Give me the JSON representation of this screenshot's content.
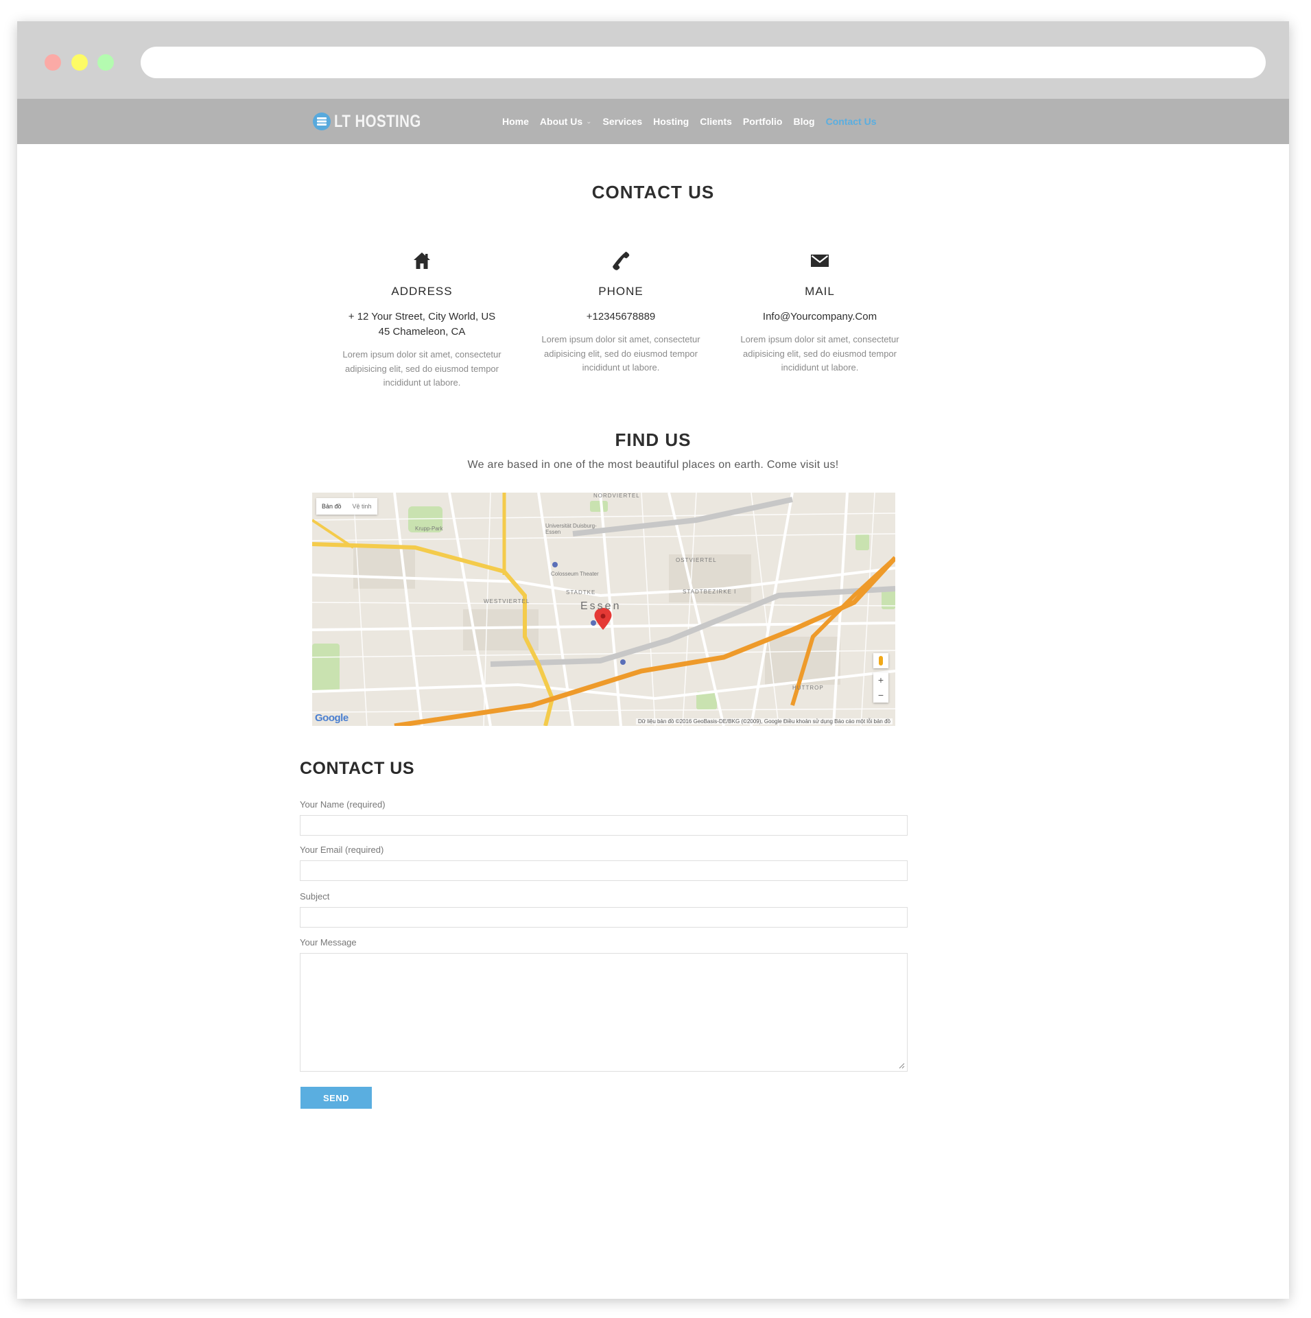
{
  "site": {
    "logo_text": "LT HOSTING"
  },
  "nav": {
    "items": [
      {
        "label": "Home"
      },
      {
        "label": "About Us"
      },
      {
        "label": "Services"
      },
      {
        "label": "Hosting"
      },
      {
        "label": "Clients"
      },
      {
        "label": "Portfolio"
      },
      {
        "label": "Blog"
      },
      {
        "label": "Contact Us"
      }
    ],
    "active_color": "#5aaee0"
  },
  "contact": {
    "title": "CONTACT US",
    "columns": [
      {
        "icon": "home-icon",
        "title": "ADDRESS",
        "value_line1": "+ 12 Your Street, City World, US",
        "value_line2": "45 Chameleon, CA",
        "text": "Lorem ipsum dolor sit amet, consectetur adipisicing elit, sed do eiusmod tempor incididunt ut labore."
      },
      {
        "icon": "phone-icon",
        "title": "PHONE",
        "value_line1": "+12345678889",
        "text": "Lorem ipsum dolor sit amet, consectetur adipisicing elit, sed do eiusmod tempor incididunt ut labore."
      },
      {
        "icon": "envelope-icon",
        "title": "MAIL",
        "value_line1": "Info@Yourcompany.Com",
        "text": "Lorem ipsum dolor sit amet, consectetur adipisicing elit, sed do eiusmod tempor incididunt ut labore."
      }
    ]
  },
  "find": {
    "title": "FIND US",
    "subtitle": "We are based in one of the most beautiful places on earth. Come visit us!"
  },
  "map": {
    "type_map": "Bản đồ",
    "type_satellite": "Vệ tinh",
    "city": "Essen",
    "labels": {
      "nordviertel": "NORDVIERTEL",
      "ostviertel": "OSTVIERTEL",
      "stadtbezirke": "STADTBEZIRKE I",
      "westviertel": "WESTVIERTEL",
      "stadtkern": "STADTKE",
      "huttrop": "HUTTROP",
      "universitat": "Universität Duisburg-Essen",
      "colosseum": "Colosseum Theater",
      "krupp_park": "Krupp-Park"
    },
    "zoom_in": "+",
    "zoom_out": "−",
    "google": "Google",
    "attribution": "Dữ liệu bản đồ ©2016 GeoBasis-DE/BKG (©2009), Google    Điều khoản sử dụng    Báo cáo một lỗi bản đồ"
  },
  "form": {
    "title": "CONTACT US",
    "name_label": "Your Name (required)",
    "email_label": "Your Email (required)",
    "subject_label": "Subject",
    "message_label": "Your Message",
    "send_label": "SEND",
    "button_color": "#5aaee0"
  }
}
